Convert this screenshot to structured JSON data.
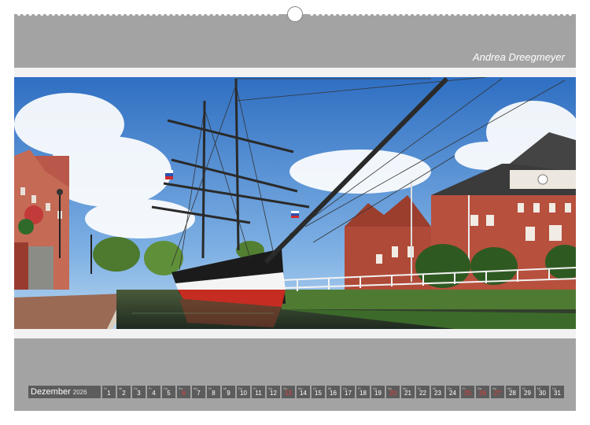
{
  "author": "Andrea Dreegmeyer",
  "month": "Dezember",
  "year": "2026",
  "days": [
    {
      "n": "1",
      "w": "Di",
      "weekend": false
    },
    {
      "n": "2",
      "w": "Mi",
      "weekend": false
    },
    {
      "n": "3",
      "w": "Do",
      "weekend": false
    },
    {
      "n": "4",
      "w": "Fr",
      "weekend": false
    },
    {
      "n": "5",
      "w": "Sa",
      "weekend": false
    },
    {
      "n": "6",
      "w": "So",
      "weekend": true
    },
    {
      "n": "7",
      "w": "Mo",
      "weekend": false
    },
    {
      "n": "8",
      "w": "Di",
      "weekend": false
    },
    {
      "n": "9",
      "w": "Mi",
      "weekend": false
    },
    {
      "n": "10",
      "w": "Do",
      "weekend": false
    },
    {
      "n": "11",
      "w": "Fr",
      "weekend": false
    },
    {
      "n": "12",
      "w": "Sa",
      "weekend": false
    },
    {
      "n": "13",
      "w": "So",
      "weekend": true
    },
    {
      "n": "14",
      "w": "Mo",
      "weekend": false
    },
    {
      "n": "15",
      "w": "Di",
      "weekend": false
    },
    {
      "n": "16",
      "w": "Mi",
      "weekend": false
    },
    {
      "n": "17",
      "w": "Do",
      "weekend": false
    },
    {
      "n": "18",
      "w": "Fr",
      "weekend": false
    },
    {
      "n": "19",
      "w": "Sa",
      "weekend": false
    },
    {
      "n": "20",
      "w": "So",
      "weekend": true
    },
    {
      "n": "21",
      "w": "Mo",
      "weekend": false
    },
    {
      "n": "22",
      "w": "Di",
      "weekend": false
    },
    {
      "n": "23",
      "w": "Mi",
      "weekend": false
    },
    {
      "n": "24",
      "w": "Do",
      "weekend": false
    },
    {
      "n": "25",
      "w": "Fr",
      "weekend": true
    },
    {
      "n": "26",
      "w": "Sa",
      "weekend": true
    },
    {
      "n": "27",
      "w": "So",
      "weekend": true
    },
    {
      "n": "28",
      "w": "Mo",
      "weekend": false
    },
    {
      "n": "29",
      "w": "Di",
      "weekend": false
    },
    {
      "n": "30",
      "w": "Mi",
      "weekend": false
    },
    {
      "n": "31",
      "w": "Do",
      "weekend": false
    }
  ]
}
